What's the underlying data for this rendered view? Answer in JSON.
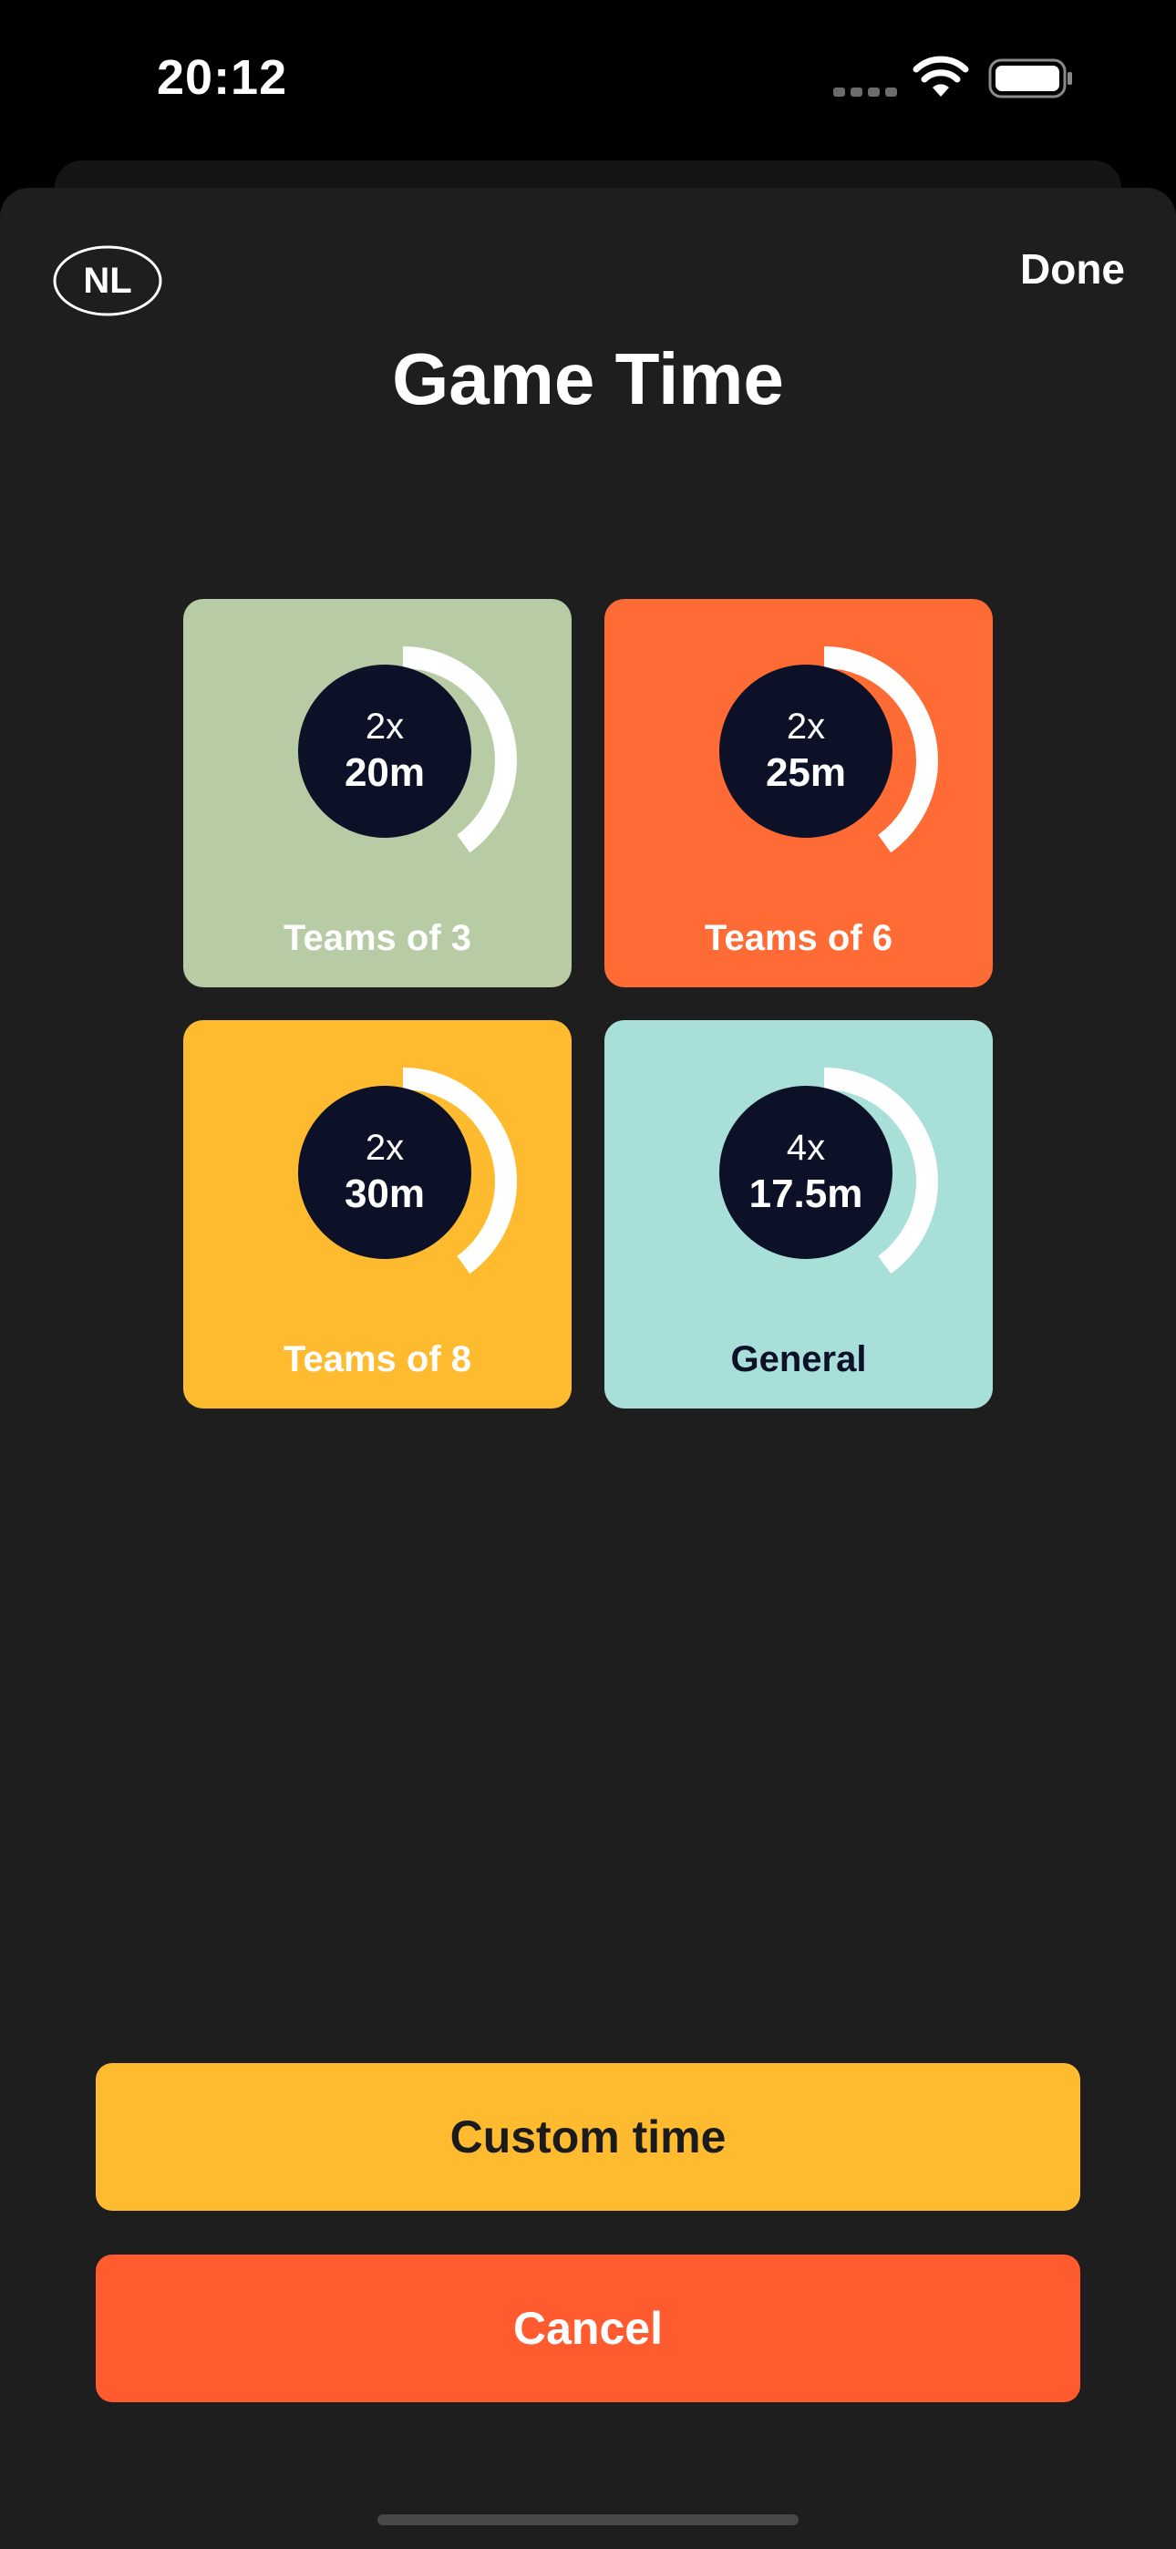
{
  "status_bar": {
    "time": "20:12",
    "wifi_icon": "wifi-icon",
    "battery_icon": "battery-icon"
  },
  "header": {
    "logo_text": "NL",
    "done_label": "Done",
    "title": "Game Time"
  },
  "presets": [
    {
      "rounds": "2x",
      "duration": "20m",
      "label": "Teams of 3",
      "bg_color": "#b7cba5",
      "text_color": "#ffffff",
      "progress": 0.4
    },
    {
      "rounds": "2x",
      "duration": "25m",
      "label": "Teams of 6",
      "bg_color": "#ff6b35",
      "text_color": "#ffffff",
      "progress": 0.4
    },
    {
      "rounds": "2x",
      "duration": "30m",
      "label": "Teams of 8",
      "bg_color": "#ffbb2f",
      "text_color": "#ffffff",
      "progress": 0.4
    },
    {
      "rounds": "4x",
      "duration": "17.5m",
      "label": "General",
      "bg_color": "#a8e0d9",
      "text_color": "#0c1128",
      "progress": 0.4
    }
  ],
  "actions": {
    "custom_label": "Custom time",
    "custom_color": "#ffbb2f",
    "cancel_label": "Cancel",
    "cancel_color": "#ff5b2e"
  },
  "colors": {
    "sheet_background": "#1e1e1f",
    "ring": "#ffffff",
    "circle": "#0c1128"
  }
}
